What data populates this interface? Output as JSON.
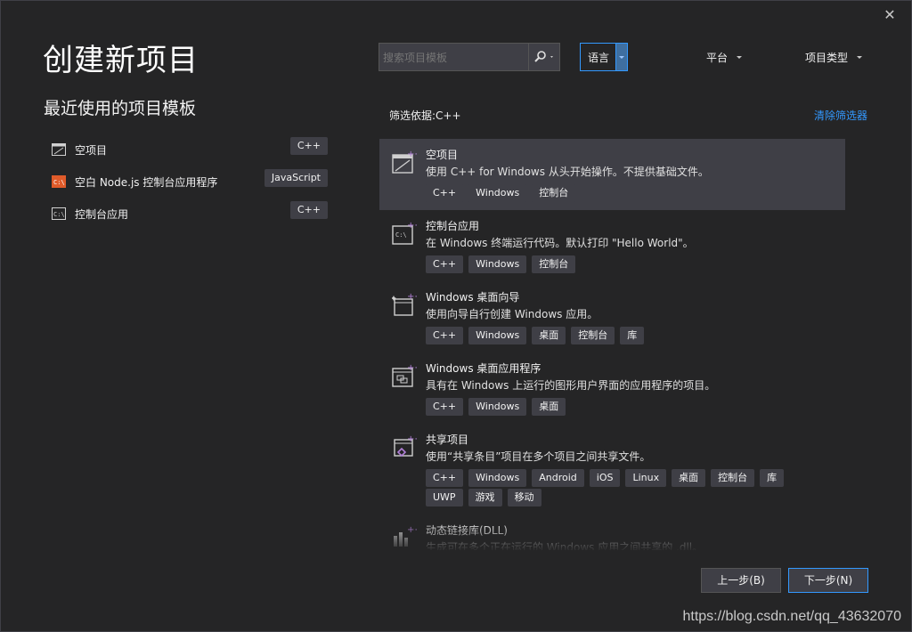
{
  "dialog": {
    "title": "创建新项目",
    "recent_title": "最近使用的项目模板",
    "close_glyph": "✕"
  },
  "recent": [
    {
      "label": "空项目",
      "tag": "C++",
      "icon": "empty-project-icon"
    },
    {
      "label": "空白 Node.js 控制台应用程序",
      "tag": "JavaScript",
      "icon": "node-console-icon"
    },
    {
      "label": "控制台应用",
      "tag": "C++",
      "icon": "console-app-icon"
    }
  ],
  "search": {
    "placeholder": "搜索项目模板",
    "icon": "search-icon"
  },
  "filters": {
    "language": "语言",
    "platform": "平台",
    "project_type": "项目类型",
    "filter_label": "筛选依据:C++",
    "clear_label": "清除筛选器"
  },
  "templates": [
    {
      "name": "空项目",
      "desc": "使用 C++ for Windows 从头开始操作。不提供基础文件。",
      "tags": [
        "C++",
        "Windows",
        "控制台"
      ],
      "icon": "empty-project-icon"
    },
    {
      "name": "控制台应用",
      "desc": "在 Windows 终端运行代码。默认打印 \"Hello World\"。",
      "tags": [
        "C++",
        "Windows",
        "控制台"
      ],
      "icon": "console-app-icon"
    },
    {
      "name": "Windows 桌面向导",
      "desc": "使用向导自行创建 Windows 应用。",
      "tags": [
        "C++",
        "Windows",
        "桌面",
        "控制台",
        "库"
      ],
      "icon": "desktop-wizard-icon"
    },
    {
      "name": "Windows 桌面应用程序",
      "desc": "具有在 Windows 上运行的图形用户界面的应用程序的项目。",
      "tags": [
        "C++",
        "Windows",
        "桌面"
      ],
      "icon": "desktop-app-icon"
    },
    {
      "name": "共享项目",
      "desc": "使用“共享条目”项目在多个项目之间共享文件。",
      "tags": [
        "C++",
        "Windows",
        "Android",
        "iOS",
        "Linux",
        "桌面",
        "控制台",
        "库"
      ],
      "tags2": [
        "UWP",
        "游戏",
        "移动"
      ],
      "icon": "shared-project-icon"
    },
    {
      "name": "动态链接库(DLL)",
      "desc": "生成可在多个正在运行的 Windows 应用之间共享的 .dll。",
      "tags": [],
      "icon": "dll-icon"
    }
  ],
  "buttons": {
    "prev": "上一步(B)",
    "next": "下一步(N)"
  },
  "watermark": "https://blog.csdn.net/qq_43632070",
  "colors": {
    "background": "#252526",
    "accent": "#3399ff",
    "selected": "#3f3f46",
    "icon_badge": "#b180d7"
  }
}
